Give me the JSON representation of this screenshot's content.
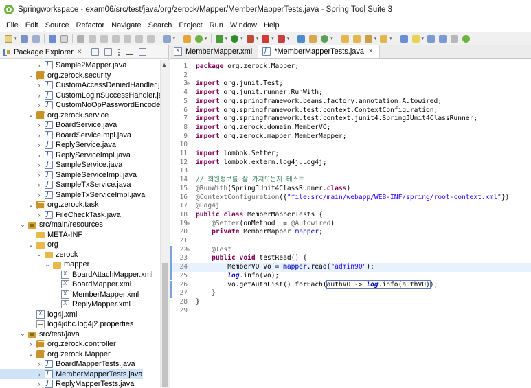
{
  "window": {
    "title": "Springworkspace - exam06/src/test/java/org/zerock/Mapper/MemberMapperTests.java - Spring Tool Suite 3"
  },
  "menu": [
    "File",
    "Edit",
    "Source",
    "Refactor",
    "Navigate",
    "Search",
    "Project",
    "Run",
    "Window",
    "Help"
  ],
  "package_explorer": {
    "title": "Package Explorer",
    "close_glyph": "✕",
    "tree": [
      {
        "label": "Sample2Mapper.java",
        "icon": "java-icon",
        "indent": 4,
        "twisty": ">"
      },
      {
        "label": "org.zerock.security",
        "icon": "package-icon",
        "indent": 3,
        "twisty": "v"
      },
      {
        "label": "CustomAccessDeniedHandler.java",
        "icon": "java-icon",
        "indent": 4,
        "twisty": ">"
      },
      {
        "label": "CustomLoginSuccessHandler.java",
        "icon": "java-icon",
        "indent": 4,
        "twisty": ">"
      },
      {
        "label": "CustomNoOpPasswordEncoder.java",
        "icon": "java-icon",
        "indent": 4,
        "twisty": ">"
      },
      {
        "label": "org.zerock.service",
        "icon": "package-icon",
        "indent": 3,
        "twisty": "v"
      },
      {
        "label": "BoardService.java",
        "icon": "java-icon",
        "indent": 4,
        "twisty": ">"
      },
      {
        "label": "BoardServiceImpl.java",
        "icon": "java-icon",
        "indent": 4,
        "twisty": ">"
      },
      {
        "label": "ReplyService.java",
        "icon": "java-icon",
        "indent": 4,
        "twisty": ">"
      },
      {
        "label": "ReplyServiceImpl.java",
        "icon": "java-icon",
        "indent": 4,
        "twisty": ">"
      },
      {
        "label": "SampleService.java",
        "icon": "java-icon",
        "indent": 4,
        "twisty": ">"
      },
      {
        "label": "SampleServiceImpl.java",
        "icon": "java-icon",
        "indent": 4,
        "twisty": ">"
      },
      {
        "label": "SampleTxService.java",
        "icon": "java-icon",
        "indent": 4,
        "twisty": ">"
      },
      {
        "label": "SampleTxServiceImpl.java",
        "icon": "java-icon",
        "indent": 4,
        "twisty": ">"
      },
      {
        "label": "org.zerock.task",
        "icon": "package-icon",
        "indent": 3,
        "twisty": "v"
      },
      {
        "label": "FileCheckTask.java",
        "icon": "java-icon",
        "indent": 4,
        "twisty": ">"
      },
      {
        "label": "src/main/resources",
        "icon": "source-folder-icon",
        "indent": 2,
        "twisty": "v"
      },
      {
        "label": "META-INF",
        "icon": "folder-icon",
        "indent": 3,
        "twisty": ""
      },
      {
        "label": "org",
        "icon": "folder-icon",
        "indent": 3,
        "twisty": "v"
      },
      {
        "label": "zerock",
        "icon": "folder-icon",
        "indent": 4,
        "twisty": "v"
      },
      {
        "label": "mapper",
        "icon": "folder-icon",
        "indent": 5,
        "twisty": "v"
      },
      {
        "label": "BoardAttachMapper.xml",
        "icon": "xml-icon",
        "indent": 6,
        "twisty": ""
      },
      {
        "label": "BoardMapper.xml",
        "icon": "xml-icon",
        "indent": 6,
        "twisty": ""
      },
      {
        "label": "MemberMapper.xml",
        "icon": "xml-icon",
        "indent": 6,
        "twisty": ""
      },
      {
        "label": "ReplyMapper.xml",
        "icon": "xml-icon",
        "indent": 6,
        "twisty": ""
      },
      {
        "label": "log4j.xml",
        "icon": "xml-icon",
        "indent": 3,
        "twisty": ""
      },
      {
        "label": "log4jdbc.log4j2.properties",
        "icon": "properties-icon",
        "indent": 3,
        "twisty": ""
      },
      {
        "label": "src/test/java",
        "icon": "source-folder-icon",
        "indent": 2,
        "twisty": "v"
      },
      {
        "label": "org.zerock.controller",
        "icon": "package-icon",
        "indent": 3,
        "twisty": ">"
      },
      {
        "label": "org.zerock.Mapper",
        "icon": "package-icon",
        "indent": 3,
        "twisty": "v"
      },
      {
        "label": "BoardMapperTests.java",
        "icon": "java-icon",
        "indent": 4,
        "twisty": ">"
      },
      {
        "label": "MemberMapperTests.java",
        "icon": "java-icon",
        "indent": 4,
        "twisty": ">",
        "selected": true
      },
      {
        "label": "ReplyMapperTests.java",
        "icon": "java-icon",
        "indent": 4,
        "twisty": ">"
      }
    ]
  },
  "editor": {
    "tabs": [
      {
        "label": "MemberMapper.xml",
        "icon": "xml-icon",
        "active": false
      },
      {
        "label": "*MemberMapperTests.java",
        "icon": "java-icon",
        "active": true,
        "close": "✕"
      }
    ],
    "lines": [
      {
        "n": "1",
        "html": "<span class='kw'>package</span> org.zerock.Mapper;"
      },
      {
        "n": "2",
        "html": ""
      },
      {
        "n": "3",
        "fold": "⊖",
        "html": "<span class='kw'>import</span> org.junit.Test;"
      },
      {
        "n": "4",
        "html": "<span class='kw'>import</span> org.junit.runner.RunWith;"
      },
      {
        "n": "5",
        "html": "<span class='kw'>import</span> org.springframework.beans.factory.annotation.Autowired;"
      },
      {
        "n": "6",
        "html": "<span class='kw'>import</span> org.springframework.test.context.ContextConfiguration;"
      },
      {
        "n": "7",
        "html": "<span class='kw'>import</span> org.springframework.test.context.junit4.SpringJUnit4ClassRunner;"
      },
      {
        "n": "8",
        "html": "<span class='kw'>import</span> org.zerock.domain.MemberVO;"
      },
      {
        "n": "9",
        "html": "<span class='kw'>import</span> org.zerock.mapper.MemberMapper;"
      },
      {
        "n": "10",
        "html": ""
      },
      {
        "n": "11",
        "html": "<span class='kw'>import</span> lombok.Setter;"
      },
      {
        "n": "12",
        "html": "<span class='kw'>import</span> lombok.extern.log4j.Log4j;"
      },
      {
        "n": "13",
        "html": ""
      },
      {
        "n": "14",
        "html": "<span class='cmt'>// 회원정보를 잘 가져오는지 테스트</span>"
      },
      {
        "n": "15",
        "html": "<span class='ann'>@RunWith</span>(SpringJUnit4ClassRunner.<span class='kw'>class</span>)"
      },
      {
        "n": "16",
        "html": "<span class='ann'>@ContextConfiguration</span>({<span class='str'>\"file:src/main/webapp/WEB-INF/spring/root-context.xml\"</span>})"
      },
      {
        "n": "17",
        "html": "<span class='ann'>@Log4j</span>"
      },
      {
        "n": "18",
        "html": "<span class='kw'>public class</span> MemberMapperTests {"
      },
      {
        "n": "19",
        "fold": "⊖",
        "html": "    <span class='ann'>@Setter</span>(onMethod_ = <span class='ann'>@Autowired</span>)"
      },
      {
        "n": "20",
        "html": "    <span class='kw'>private</span> MemberMapper <span class='fld'>mapper</span>;"
      },
      {
        "n": "21",
        "html": ""
      },
      {
        "n": "22",
        "fold": "⊖",
        "marker": true,
        "html": "    <span class='ann'>@Test</span>"
      },
      {
        "n": "23",
        "marker": true,
        "html": "    <span class='kw'>public void</span> testRead() {"
      },
      {
        "n": "24",
        "marker": true,
        "hl": true,
        "html": "        MemberVO vo = <span class='fld'>mapper</span>.read(<span class='str'>\"admin90\"</span>);"
      },
      {
        "n": "25",
        "marker": true,
        "html": "        <span class='fld st'>log</span>.info(vo);"
      },
      {
        "n": "26",
        "marker": true,
        "html": "        vo.getAuthList().forEach(<span class='boxed'>authVO -&gt; <span class='fld st'>log</span>.info(authVO)</span>);"
      },
      {
        "n": "27",
        "marker": true,
        "html": "    }"
      },
      {
        "n": "28",
        "html": "}"
      },
      {
        "n": "29",
        "html": ""
      }
    ]
  },
  "colors": {
    "keyword": "#7f0055",
    "string": "#2a00ff",
    "annotation": "#646464",
    "comment": "#3f7f5f",
    "field": "#0000c0",
    "selection": "#cfe3f8"
  }
}
